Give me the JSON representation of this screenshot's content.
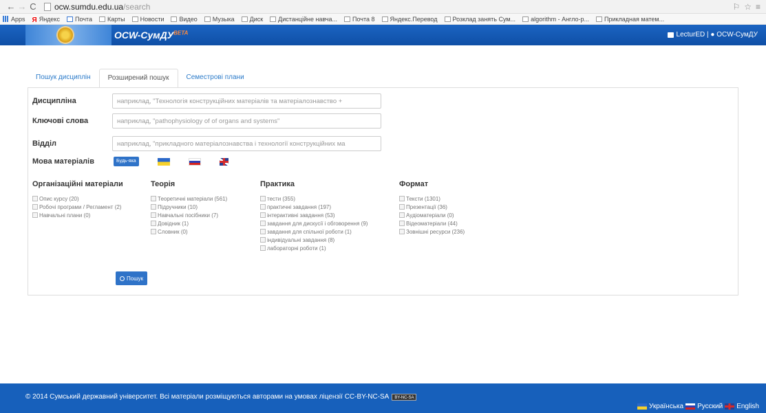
{
  "browser": {
    "url_host": "ocw.sumdu.edu.ua",
    "url_path": "/search",
    "bookmarks": [
      "Apps",
      "Яндекс",
      "Почта",
      "Карты",
      "Новости",
      "Видео",
      "Музыка",
      "Диск",
      "Дистанційне навча...",
      "Почта 8",
      "Яндекс.Перевод",
      "Розклад занять Сум...",
      "algorithm - Англо-р...",
      "Прикладная матем..."
    ]
  },
  "header": {
    "title": "OCW-СумДУ",
    "beta": "BETA",
    "right_text": "LecturED | ● OCW-СумДУ"
  },
  "tabs": [
    {
      "label": "Пошук дисциплін"
    },
    {
      "label": "Розширений пошук"
    },
    {
      "label": "Семестрові плани"
    }
  ],
  "form": {
    "discipline_label": "Дисципліна",
    "discipline_placeholder": "наприклад, \"Технологія конструкційних матеріалів та матеріалознавство +",
    "keywords_label": "Ключові слова",
    "keywords_placeholder": "наприклад, \"pathophysiology of of organs and systems\"",
    "department_label": "Відділ",
    "department_placeholder": "наприклад, \"прикладного матеріалознавства і технології конструкційних ма",
    "language_label": "Мова матеріалів",
    "any_language": "Будь-яка"
  },
  "columns": {
    "org": {
      "title": "Організаційні матеріали",
      "items": [
        "Опис курсу (20)",
        "Робочі програми / Регламент (2)",
        "Навчальні плани (0)"
      ]
    },
    "theory": {
      "title": "Теорія",
      "items": [
        "Теоретичні матеріали (561)",
        "Підручники (10)",
        "Навчальні посібники (7)",
        "Довідник (1)",
        "Словник (0)"
      ]
    },
    "practice": {
      "title": "Практика",
      "items": [
        "тести (355)",
        "практичні завдання (197)",
        "інтерактивні завдання (53)",
        "завдання для дискусії і обговорення (9)",
        "завдання для спільної роботи (1)",
        "індивідуальні завдання (8)",
        "лабораторні роботи (1)"
      ]
    },
    "format": {
      "title": "Формат",
      "items": [
        "Тексти (1301)",
        "Презентації (36)",
        "Аудіоматеріали (0)",
        "Відеоматеріали (44)",
        "Зовнішні ресурси (236)"
      ]
    }
  },
  "search_button": "Пошук",
  "footer": {
    "copyright": "© 2014 Сумський державний університет. Всі матеріали розміщуються авторами на умовах ліцензії CC-BY-NC-SA",
    "cc_badge": "BY-NC-SA",
    "lang_ua": "Українська",
    "lang_ru": "Русский",
    "lang_en": "English"
  },
  "colors": {
    "header_blue": "#1760bb",
    "accent_blue": "#2f73c8",
    "link_blue": "#2a7ac9"
  }
}
